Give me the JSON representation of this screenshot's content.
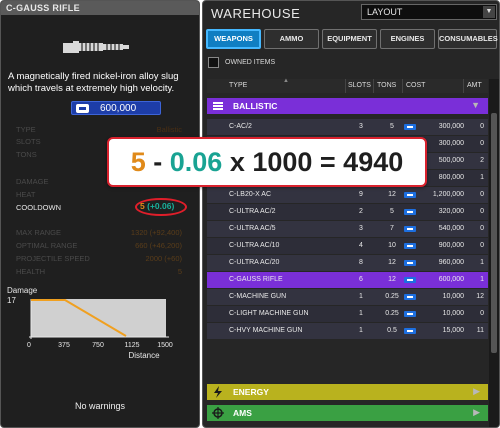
{
  "left_panel": {
    "title": "C-GAUSS RIFLE",
    "description": "A magnetically fired nickel-iron alloy slug which travels at extremely high velocity.",
    "cost": "600,000",
    "stats": [
      {
        "label": "TYPE",
        "value": "Ballistic"
      },
      {
        "label": "SLOTS",
        "value": ""
      },
      {
        "label": "TONS",
        "value": ""
      },
      {
        "label": "DAMAGE",
        "value": ""
      },
      {
        "label": "HEAT",
        "value": ""
      },
      {
        "label": "COOLDOWN",
        "value": "5",
        "delta": "(+0.06)"
      },
      {
        "label": "MAX RANGE",
        "value": "1320 (+92,400)"
      },
      {
        "label": "OPTIMAL RANGE",
        "value": "660 (+46,200)"
      },
      {
        "label": "PROJECTILE SPEED",
        "value": "2000 (+60)"
      },
      {
        "label": "HEALTH",
        "value": "5"
      }
    ],
    "damage_chart": {
      "label": "Damage",
      "y_tick": "17",
      "x_ticks": [
        "0",
        "375",
        "750",
        "1125",
        "1500"
      ],
      "x_label": "Distance"
    },
    "warnings": "No warnings"
  },
  "warehouse": {
    "title": "WAREHOUSE",
    "layout_select": "LAYOUT",
    "tabs": [
      "WEAPONS",
      "AMMO",
      "EQUIPMENT",
      "ENGINES",
      "CONSUMABLES"
    ],
    "active_tab": "WEAPONS",
    "owned_items_label": "OWNED ITEMS",
    "columns": [
      "TYPE",
      "SLOTS",
      "TONS",
      "COST",
      "AMT"
    ],
    "categories": {
      "ballistic": "BALLISTIC",
      "energy": "ENERGY",
      "ams": "AMS"
    },
    "rows": [
      {
        "name": "C-AC/2",
        "slots": "3",
        "tons": "5",
        "cost": "300,000",
        "amt": "0"
      },
      {
        "name": "C-LB2-X AC",
        "slots": "3",
        "tons": "5",
        "cost": "300,000",
        "amt": "0"
      },
      {
        "name": "C-LB5-X AC",
        "slots": "4",
        "tons": "7",
        "cost": "500,000",
        "amt": "2"
      },
      {
        "name": "C-LB10-X AC",
        "slots": "5",
        "tons": "10",
        "cost": "800,000",
        "amt": "1"
      },
      {
        "name": "C-LB20-X AC",
        "slots": "9",
        "tons": "12",
        "cost": "1,200,000",
        "amt": "0"
      },
      {
        "name": "C-ULTRA AC/2",
        "slots": "2",
        "tons": "5",
        "cost": "320,000",
        "amt": "0"
      },
      {
        "name": "C-ULTRA AC/5",
        "slots": "3",
        "tons": "7",
        "cost": "540,000",
        "amt": "0"
      },
      {
        "name": "C-ULTRA AC/10",
        "slots": "4",
        "tons": "10",
        "cost": "900,000",
        "amt": "0"
      },
      {
        "name": "C-ULTRA AC/20",
        "slots": "8",
        "tons": "12",
        "cost": "960,000",
        "amt": "1"
      },
      {
        "name": "C-GAUSS RIFLE",
        "slots": "6",
        "tons": "12",
        "cost": "600,000",
        "amt": "1"
      },
      {
        "name": "C-MACHINE GUN",
        "slots": "1",
        "tons": "0.25",
        "cost": "10,000",
        "amt": "12"
      },
      {
        "name": "C-LIGHT MACHINE GUN",
        "slots": "1",
        "tons": "0.25",
        "cost": "10,000",
        "amt": "0"
      },
      {
        "name": "C-HVY MACHINE GUN",
        "slots": "1",
        "tons": "0.5",
        "cost": "15,000",
        "amt": "11"
      }
    ]
  },
  "equation": {
    "a": "5",
    "minus": " - ",
    "b": "0.06",
    "rest": " x 1000 = 4940"
  },
  "colors": {
    "accent_purple": "#7a2fd8",
    "active_tab_blue": "#107ec2",
    "energy_yellow": "#b9b21e",
    "ams_green": "#3aa043",
    "highlight_red": "#d9222e",
    "orange_value": "#e08a1a",
    "teal_value": "#19a393"
  }
}
